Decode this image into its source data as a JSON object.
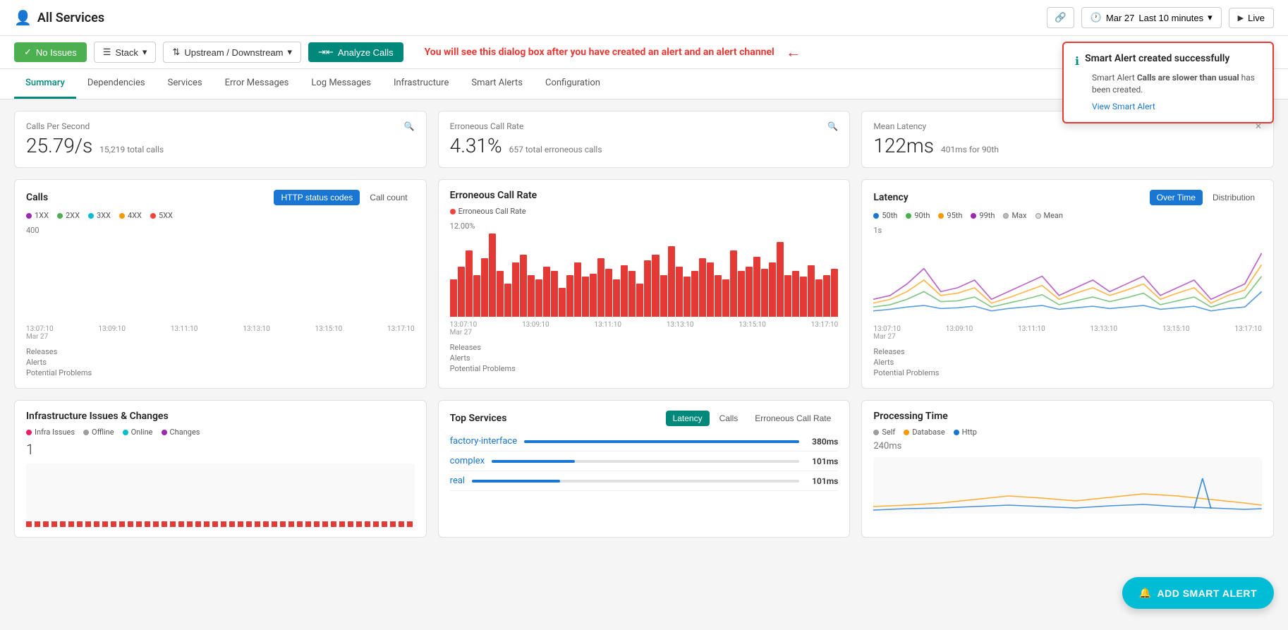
{
  "header": {
    "title": "All Services",
    "link_icon": "🔗",
    "time_icon": "🕐",
    "date": "Mar 27",
    "time_range": "Last 10 minutes",
    "live_label": "Live"
  },
  "toolbar": {
    "no_issues_label": "No Issues",
    "stack_label": "Stack",
    "upstream_downstream_label": "Upstream / Downstream",
    "analyze_calls_label": "Analyze Calls",
    "annotation": "You will see this dialog box after you have created an alert and an alert channel"
  },
  "smart_alert_popup": {
    "title": "Smart Alert created successfully",
    "body_prefix": "Smart Alert",
    "alert_name": "Calls are slower than usual",
    "body_suffix": "has been created.",
    "link_label": "View Smart Alert"
  },
  "nav": {
    "tabs": [
      "Summary",
      "Dependencies",
      "Services",
      "Error Messages",
      "Log Messages",
      "Infrastructure",
      "Smart Alerts",
      "Configuration"
    ],
    "active": "Summary"
  },
  "metrics": [
    {
      "label": "Calls Per Second",
      "value": "25.79/s",
      "sub": "15,219 total calls"
    },
    {
      "label": "Erroneous Call Rate",
      "value": "4.31%",
      "sub": "657 total erroneous calls"
    },
    {
      "label": "Mean Latency",
      "value": "122ms",
      "sub": "401ms for 90th"
    }
  ],
  "calls_chart": {
    "title": "Calls",
    "btn_active": "HTTP status codes",
    "btn_inactive": "Call count",
    "legend": [
      {
        "label": "1XX",
        "color": "#9c27b0"
      },
      {
        "label": "2XX",
        "color": "#4caf50"
      },
      {
        "label": "3XX",
        "color": "#00bcd4"
      },
      {
        "label": "4XX",
        "color": "#ff9800"
      },
      {
        "label": "5XX",
        "color": "#f44336"
      }
    ],
    "y_max": "400",
    "timestamps": [
      "13:07:10\nMar 27",
      "13:09:10",
      "13:11:10",
      "13:13:10",
      "13:15:10",
      "13:17:10"
    ],
    "footer_items": [
      "Releases",
      "Alerts",
      "Potential Problems"
    ]
  },
  "erroneous_chart": {
    "title": "Erroneous Call Rate",
    "legend": [
      {
        "label": "Erroneous Call Rate",
        "color": "#f44336"
      }
    ],
    "y_max": "12.00%",
    "timestamps": [
      "13:07:10\nMar 27",
      "13:09:10",
      "13:11:10",
      "13:13:10",
      "13:15:10",
      "13:17:10"
    ],
    "footer_items": [
      "Releases",
      "Alerts",
      "Potential Problems"
    ]
  },
  "latency_chart": {
    "title": "Latency",
    "btn_over_time": "Over Time",
    "btn_distribution": "Distribution",
    "legend": [
      {
        "label": "50th",
        "color": "#1976d2"
      },
      {
        "label": "90th",
        "color": "#4caf50"
      },
      {
        "label": "95th",
        "color": "#ff9800"
      },
      {
        "label": "99th",
        "color": "#9c27b0"
      },
      {
        "label": "Max",
        "color": "#bbb"
      },
      {
        "label": "Mean",
        "color": "#ddd"
      }
    ],
    "y_max": "1s",
    "timestamps": [
      "13:07:10\nMar 27",
      "13:09:10",
      "13:11:10",
      "13:13:10",
      "13:15:10",
      "13:17:10"
    ],
    "footer_items": [
      "Releases",
      "Alerts",
      "Potential Problems"
    ]
  },
  "infra_card": {
    "title": "Infrastructure Issues & Changes",
    "legend": [
      {
        "label": "Infra Issues",
        "color": "#e91e63"
      },
      {
        "label": "Offline",
        "color": "#9e9e9e"
      },
      {
        "label": "Online",
        "color": "#00bcd4"
      },
      {
        "label": "Changes",
        "color": "#9c27b0"
      }
    ],
    "count": "1"
  },
  "top_services_card": {
    "title": "Top Services",
    "btn_active": "Latency",
    "btn_calls": "Calls",
    "btn_erroneous": "Erroneous Call Rate",
    "services": [
      {
        "name": "factory-interface",
        "value": "380ms",
        "pct": 100
      },
      {
        "name": "complex",
        "value": "101ms",
        "pct": 27
      },
      {
        "name": "real",
        "value": "101ms",
        "pct": 27
      }
    ]
  },
  "processing_card": {
    "title": "Processing Time",
    "legend": [
      {
        "label": "Self",
        "color": "#9e9e9e"
      },
      {
        "label": "Database",
        "color": "#ff9800"
      },
      {
        "label": "Http",
        "color": "#1976d2"
      }
    ],
    "y_max": "240ms"
  },
  "add_alert_btn": "ADD SMART ALERT"
}
